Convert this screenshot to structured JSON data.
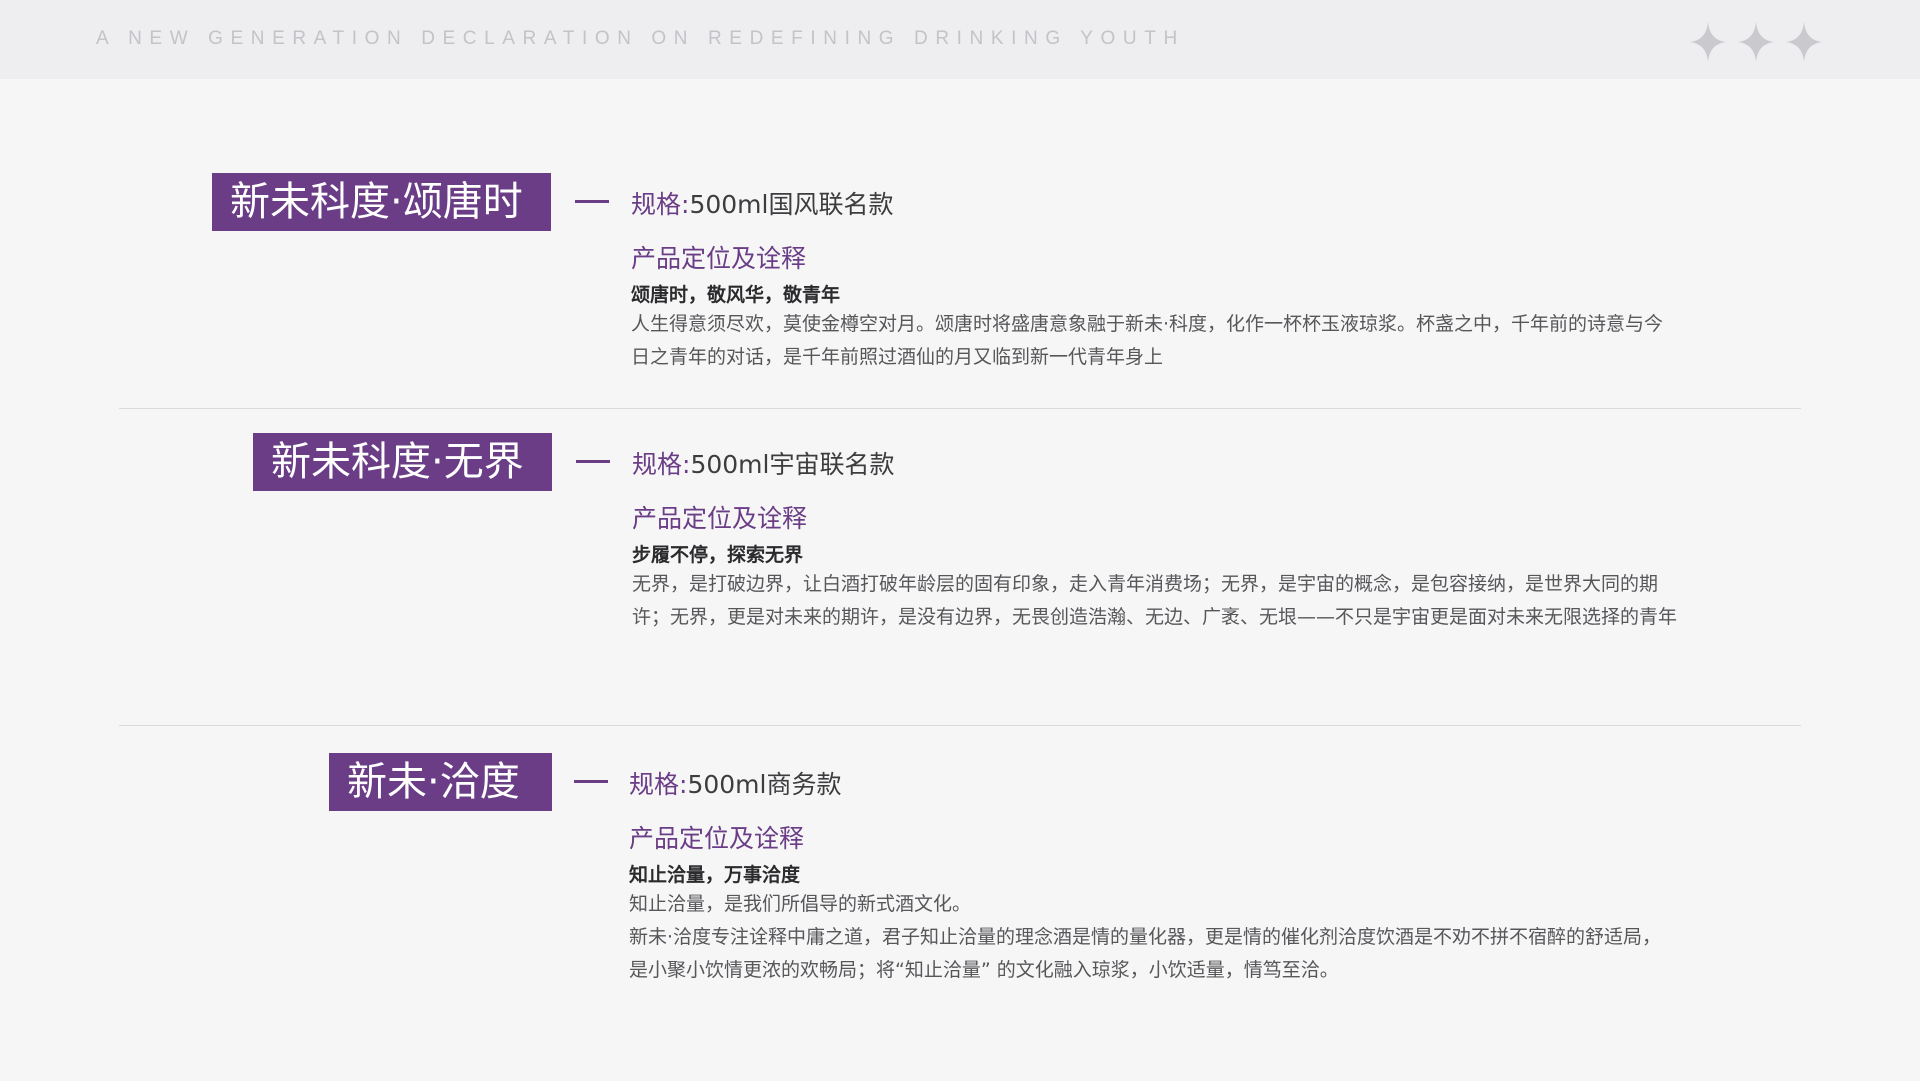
{
  "header": {
    "tagline": "A NEW GENERATION DECLARATION ON REDEFINING DRINKING YOUTH",
    "decor_icons": [
      "sparkle-star-icon",
      "sparkle-star-icon",
      "sparkle-star-icon"
    ]
  },
  "colors": {
    "accent": "#6a3d86",
    "background": "#f6f6f7",
    "header_band": "#eeeef0",
    "text_dark": "#2b2b2d",
    "text_body": "#57575a"
  },
  "products": [
    {
      "tag": "新未科度·颂唐时",
      "spec_label": "规格:",
      "spec_value": "500ml国风联名款",
      "section_heading": "产品定位及诠释",
      "slogan": "颂唐时，敬风华，敬青年",
      "body": [
        "人生得意须尽欢，莫使金樽空对月。颂唐时将盛唐意象融于新未·科度，化作一杯杯玉液琼浆。杯盏之中，千年前的诗意与今日之青年的对话，是千年前照过酒仙的月又临到新一代青年身上"
      ]
    },
    {
      "tag": "新未科度·无界",
      "spec_label": "规格:",
      "spec_value": "500ml宇宙联名款",
      "section_heading": "产品定位及诠释",
      "slogan": "步履不停，探索无界",
      "body": [
        "无界，是打破边界，让白酒打破年龄层的固有印象，走入青年消费场；无界，是宇宙的概念，是包容接纳，是世界大同的期许；无界，更是对未来的期许，是没有边界，无畏创造浩瀚、无边、广袤、无垠——不只是宇宙更是面对未来无限选择的青年"
      ]
    },
    {
      "tag": "新未·洽度",
      "spec_label": "规格:",
      "spec_value": "500ml商务款",
      "section_heading": "产品定位及诠释",
      "slogan": "知止洽量，万事洽度",
      "body": [
        "知止洽量，是我们所倡导的新式酒文化。",
        "新未·洽度专注诠释中庸之道，君子知止洽量的理念酒是情的量化器，更是情的催化剂洽度饮酒是不劝不拼不宿醉的舒适局，是小聚小饮情更浓的欢畅局；将“知止洽量” 的文化融入琼浆，小饮适量，情笃至洽。"
      ]
    }
  ]
}
